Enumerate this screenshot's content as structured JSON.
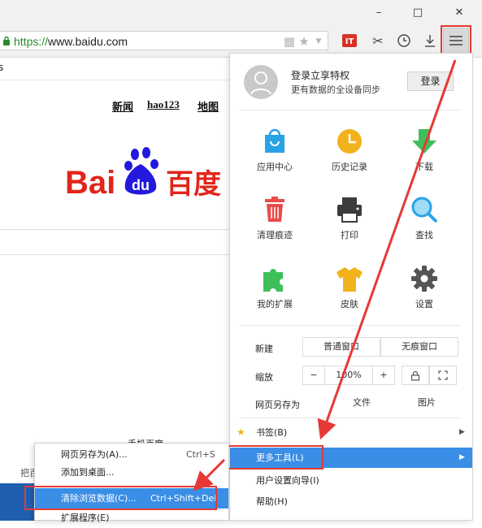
{
  "window": {
    "minimize": "–",
    "maximize": "□",
    "close": "✕"
  },
  "address_bar": {
    "scheme": "https://",
    "rest": "www.baidu.com"
  },
  "page": {
    "left_edge_text": "s",
    "links": [
      "新闻",
      "hao123",
      "地图"
    ],
    "logo_text": {
      "bai": "Bai",
      "du": "du",
      "cn": "百度"
    },
    "footer_fragment": "手机百度",
    "footer_fragment2": "把百"
  },
  "main_menu": {
    "login_line1": "登录立享特权",
    "login_line2": "更有数据的全设备同步",
    "login_button": "登录",
    "grid": [
      {
        "label": "应用中心",
        "icon": "app-center-icon",
        "color": "#29a3e6"
      },
      {
        "label": "历史记录",
        "icon": "history-icon",
        "color": "#f2b21c"
      },
      {
        "label": "下载",
        "icon": "download-icon",
        "color": "#3fbf5a"
      },
      {
        "label": "清理痕迹",
        "icon": "trash-icon",
        "color": "#e84a4a"
      },
      {
        "label": "打印",
        "icon": "printer-icon",
        "color": "#3c3c3c"
      },
      {
        "label": "查找",
        "icon": "search-icon",
        "color": "#2aa3e6"
      },
      {
        "label": "我的扩展",
        "icon": "puzzle-icon",
        "color": "#3fbf5a"
      },
      {
        "label": "皮肤",
        "icon": "shirt-icon",
        "color": "#f2b21c"
      },
      {
        "label": "设置",
        "icon": "gear-icon",
        "color": "#555555"
      }
    ],
    "new": {
      "label": "新建",
      "normal": "普通窗口",
      "incognito": "无痕窗口"
    },
    "zoom": {
      "label": "缩放",
      "minus": "−",
      "value": "100%",
      "plus": "+"
    },
    "save_as": {
      "label": "网页另存为",
      "file": "文件",
      "image": "图片"
    },
    "bookmarks": "书签(B)",
    "more_tools": "更多工具(L)",
    "setup_wizard": "用户设置向导(I)",
    "help": "帮助(H)"
  },
  "sub_menu": {
    "items": [
      {
        "label": "网页另存为(A)...",
        "shortcut": "Ctrl+S"
      },
      {
        "label": "添加到桌面...",
        "shortcut": ""
      },
      {
        "label": "清除浏览数据(C)...",
        "shortcut": "Ctrl+Shift+Del"
      },
      {
        "label": "扩展程序(E)",
        "shortcut": ""
      }
    ]
  },
  "colors": {
    "highlight": "#3a8ee6",
    "annotation": "#e53935",
    "baidu_red": "#e1251b",
    "baidu_blue": "#2319dc"
  }
}
